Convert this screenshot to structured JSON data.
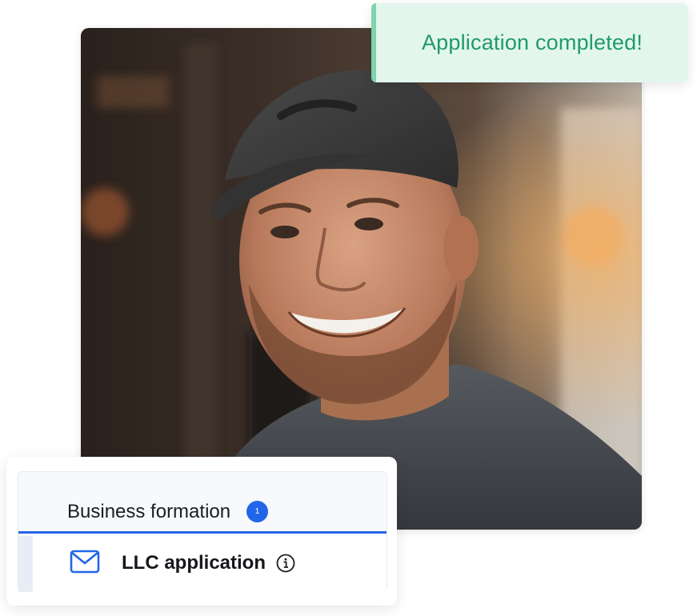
{
  "toast": {
    "message": "Application completed!",
    "accent_color": "#7fd3ad",
    "text_color": "#1f9a6b",
    "background": "#e3f6ee"
  },
  "photo": {
    "icon": "portrait-photo"
  },
  "card": {
    "tab": {
      "label": "Business formation",
      "badge_count": "1",
      "accent_color": "#2563eb"
    },
    "item": {
      "icon": "envelope-icon",
      "label": "LLC application",
      "info_icon": "info-icon"
    }
  }
}
